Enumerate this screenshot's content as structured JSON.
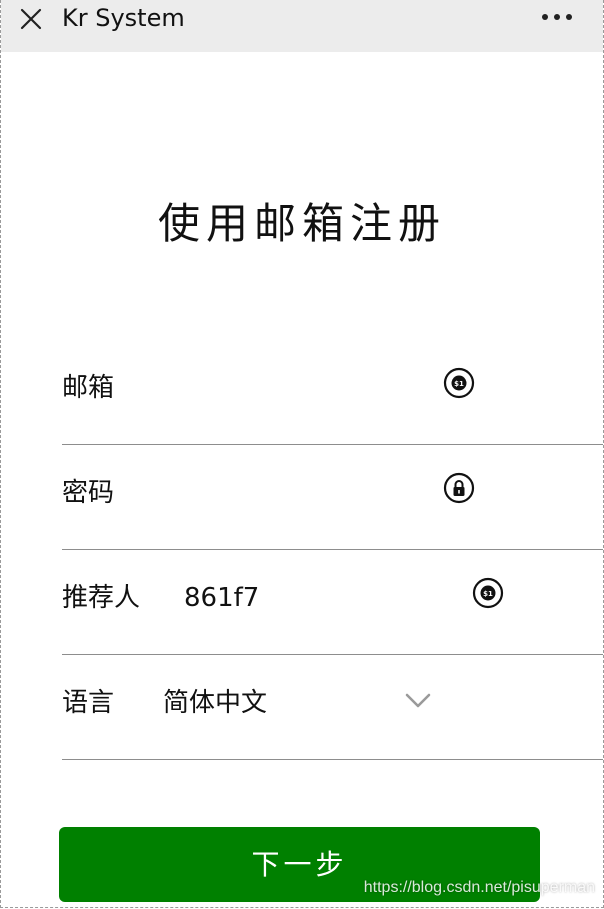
{
  "header": {
    "title": "Kr System"
  },
  "page_title": "使用邮箱注册",
  "form": {
    "email": {
      "label": "邮箱",
      "value": "",
      "icon": "email-icon"
    },
    "password": {
      "label": "密码",
      "value": "",
      "icon": "lock-icon"
    },
    "referrer": {
      "label": "推荐人",
      "value": "861f7",
      "icon": "referrer-icon"
    },
    "language": {
      "label": "语言",
      "value": "简体中文",
      "icon": "chevron-down-icon"
    }
  },
  "next_button": {
    "label": "下一步"
  },
  "watermark": "https://blog.csdn.net/pisuperman",
  "colors": {
    "topbar": "#ececec",
    "button": "#008000",
    "divider": "#8d8d8d"
  }
}
